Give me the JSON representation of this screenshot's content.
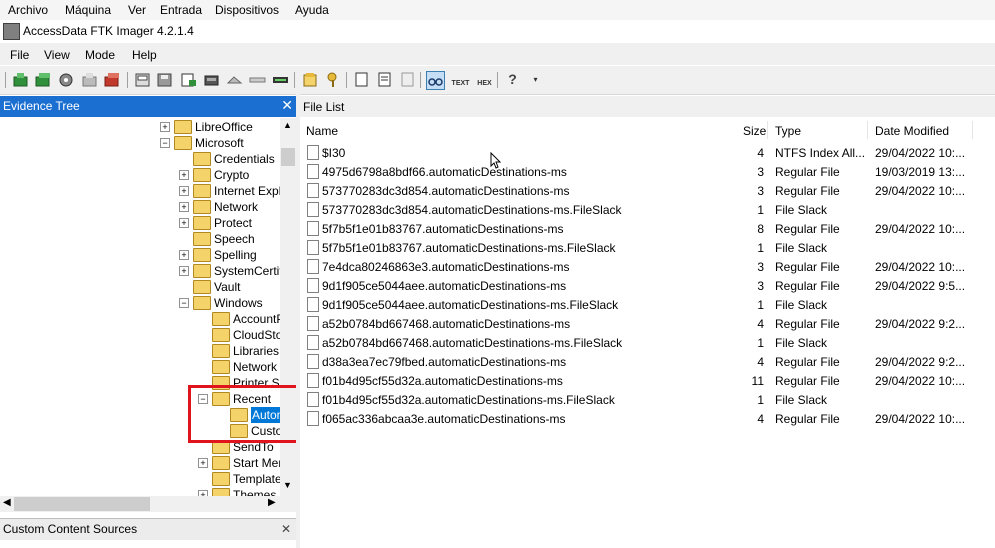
{
  "vm_menu": [
    "Archivo",
    "Máquina",
    "Ver",
    "Entrada",
    "Dispositivos",
    "Ayuda"
  ],
  "window": {
    "title": "AccessData FTK Imager 4.2.1.4"
  },
  "app_menu": [
    "File",
    "View",
    "Mode",
    "Help"
  ],
  "evidence_tree": {
    "title": "Evidence Tree",
    "nodes": [
      {
        "label": "LibreOffice"
      },
      {
        "label": "Microsoft"
      },
      {
        "label": "Credentials"
      },
      {
        "label": "Crypto"
      },
      {
        "label": "Internet Explo"
      },
      {
        "label": "Network"
      },
      {
        "label": "Protect"
      },
      {
        "label": "Speech"
      },
      {
        "label": "Spelling"
      },
      {
        "label": "SystemCertific"
      },
      {
        "label": "Vault"
      },
      {
        "label": "Windows"
      },
      {
        "label": "AccountP"
      },
      {
        "label": "CloudStor"
      },
      {
        "label": "Libraries"
      },
      {
        "label": "Network S"
      },
      {
        "label": "Printer Sh"
      },
      {
        "label": "Recent"
      },
      {
        "label": "Autom"
      },
      {
        "label": "Custo"
      },
      {
        "label": "SendTo"
      },
      {
        "label": "Start Men"
      },
      {
        "label": "Templates"
      },
      {
        "label": "Themes"
      }
    ]
  },
  "custom_content": {
    "title": "Custom Content Sources"
  },
  "file_list": {
    "title": "File List",
    "columns": {
      "name": "Name",
      "size": "Size",
      "type": "Type",
      "date": "Date Modified"
    },
    "rows": [
      {
        "name": "$I30",
        "size": "4",
        "type": "NTFS Index All...",
        "date": "29/04/2022 10:..."
      },
      {
        "name": "4975d6798a8bdf66.automaticDestinations-ms",
        "size": "3",
        "type": "Regular File",
        "date": "19/03/2019 13:..."
      },
      {
        "name": "573770283dc3d854.automaticDestinations-ms",
        "size": "3",
        "type": "Regular File",
        "date": "29/04/2022 10:..."
      },
      {
        "name": "573770283dc3d854.automaticDestinations-ms.FileSlack",
        "size": "1",
        "type": "File Slack",
        "date": ""
      },
      {
        "name": "5f7b5f1e01b83767.automaticDestinations-ms",
        "size": "8",
        "type": "Regular File",
        "date": "29/04/2022 10:..."
      },
      {
        "name": "5f7b5f1e01b83767.automaticDestinations-ms.FileSlack",
        "size": "1",
        "type": "File Slack",
        "date": ""
      },
      {
        "name": "7e4dca80246863e3.automaticDestinations-ms",
        "size": "3",
        "type": "Regular File",
        "date": "29/04/2022 10:..."
      },
      {
        "name": "9d1f905ce5044aee.automaticDestinations-ms",
        "size": "3",
        "type": "Regular File",
        "date": "29/04/2022 9:5..."
      },
      {
        "name": "9d1f905ce5044aee.automaticDestinations-ms.FileSlack",
        "size": "1",
        "type": "File Slack",
        "date": ""
      },
      {
        "name": "a52b0784bd667468.automaticDestinations-ms",
        "size": "4",
        "type": "Regular File",
        "date": "29/04/2022 9:2..."
      },
      {
        "name": "a52b0784bd667468.automaticDestinations-ms.FileSlack",
        "size": "1",
        "type": "File Slack",
        "date": ""
      },
      {
        "name": "d38a3ea7ec79fbed.automaticDestinations-ms",
        "size": "4",
        "type": "Regular File",
        "date": "29/04/2022 9:2..."
      },
      {
        "name": "f01b4d95cf55d32a.automaticDestinations-ms",
        "size": "11",
        "type": "Regular File",
        "date": "29/04/2022 10:..."
      },
      {
        "name": "f01b4d95cf55d32a.automaticDestinations-ms.FileSlack",
        "size": "1",
        "type": "File Slack",
        "date": ""
      },
      {
        "name": "f065ac336abcaa3e.automaticDestinations-ms",
        "size": "4",
        "type": "Regular File",
        "date": "29/04/2022 10:..."
      }
    ]
  },
  "toolbar_buttons": [
    {
      "icon": "add-evidence-icon"
    },
    {
      "icon": "add-all-evidence-icon"
    },
    {
      "icon": "image-mounting-icon"
    },
    {
      "icon": "remove-evidence-icon"
    },
    {
      "icon": "remove-all-evidence-icon"
    },
    {
      "icon": "create-image-icon"
    },
    {
      "icon": "export-disk-image-icon"
    },
    {
      "icon": "export-logical-image-icon"
    },
    {
      "icon": "add-to-custom-content-icon"
    },
    {
      "icon": "create-custom-image-icon"
    },
    {
      "icon": "decrypt-icon"
    },
    {
      "icon": "detect-efs-icon"
    },
    {
      "icon": "export-files-icon"
    },
    {
      "icon": "export-file-hash-icon"
    },
    {
      "icon": "capture-memory-icon"
    },
    {
      "icon": "obtain-protected-files-icon"
    },
    {
      "icon": "auto-view-icon"
    },
    {
      "icon": "text-view-icon"
    },
    {
      "icon": "hex-view-icon"
    },
    {
      "icon": "help-icon"
    }
  ]
}
